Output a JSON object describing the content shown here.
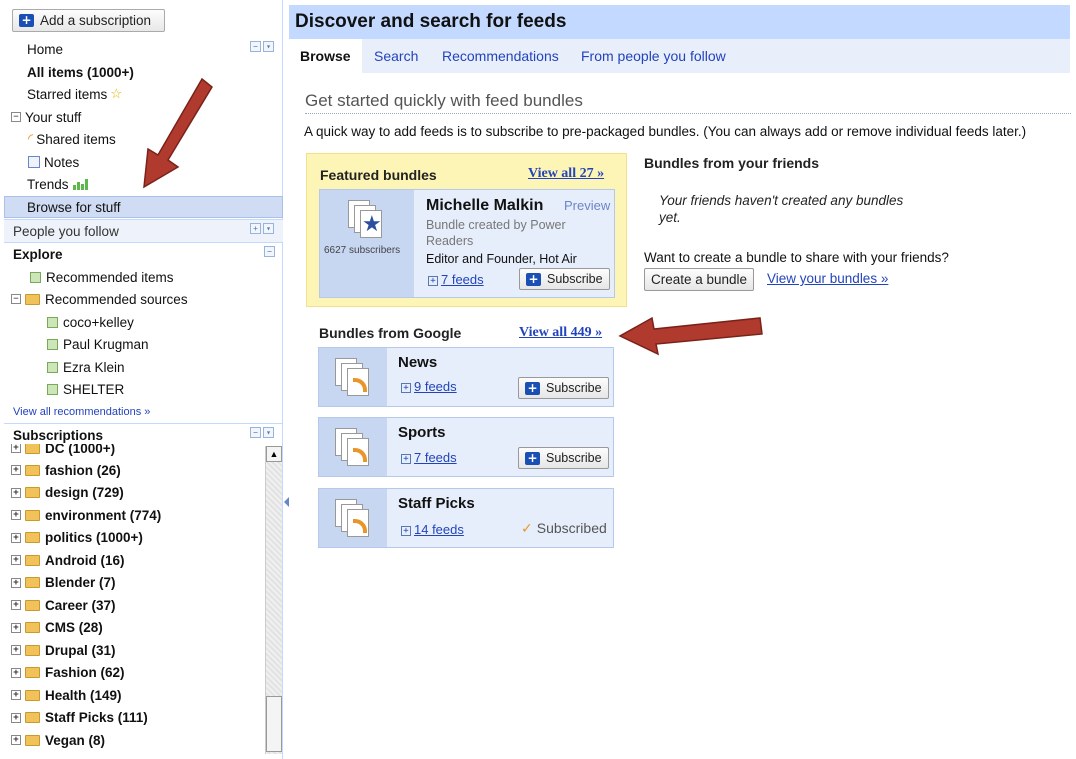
{
  "sidebar": {
    "add_subscription": "Add a subscription",
    "nav": {
      "home": "Home",
      "all_items": "All items (1000+)",
      "starred": "Starred items",
      "your_stuff": "Your stuff",
      "shared": "Shared items",
      "notes": "Notes",
      "trends": "Trends",
      "browse": "Browse for stuff"
    },
    "people_you_follow": "People you follow",
    "explore": {
      "title": "Explore",
      "recommended_items": "Recommended items",
      "recommended_sources": "Recommended sources",
      "sources": [
        "coco+kelley",
        "Paul Krugman",
        "Ezra Klein",
        "SHELTER"
      ],
      "view_all": "View all recommendations »"
    },
    "subscriptions": {
      "title": "Subscriptions",
      "partial": "DC (1000+)",
      "folders": [
        "fashion (26)",
        "design (729)",
        "environment (774)",
        "politics (1000+)",
        "Android (16)",
        "Blender (7)",
        "Career (37)",
        "CMS (28)",
        "Drupal (31)",
        "Fashion (62)",
        "Health (149)",
        "Staff Picks (111)",
        "Vegan (8)"
      ]
    }
  },
  "main": {
    "title": "Discover and search for feeds",
    "tabs": [
      "Browse",
      "Search",
      "Recommendations",
      "From people you follow"
    ],
    "heading": "Get started quickly with feed bundles",
    "intro": "A quick way to add feeds is to subscribe to pre-packaged bundles. (You can always add or remove individual feeds later.)",
    "featured": {
      "title": "Featured bundles",
      "view_all": "View all 27 »",
      "bundle": {
        "name": "Michelle Malkin",
        "preview": "Preview",
        "by": "Bundle created by Power Readers",
        "desc": "Editor and Founder, Hot Air",
        "subscribers": "6627 subscribers",
        "feeds": "7 feeds",
        "subscribe": "Subscribe"
      }
    },
    "friends": {
      "title": "Bundles from your friends",
      "none": "Your friends haven't created any bundles yet.",
      "want": "Want to create a bundle to share with your friends?",
      "create": "Create a bundle",
      "view_yours": "View your bundles »"
    },
    "google": {
      "title": "Bundles from Google",
      "view_all": "View all 449 »",
      "bundles": [
        {
          "name": "News",
          "feeds": "9 feeds",
          "action": "Subscribe"
        },
        {
          "name": "Sports",
          "feeds": "7 feeds",
          "action": "Subscribe"
        },
        {
          "name": "Staff Picks",
          "feeds": "14 feeds",
          "action": "Subscribed"
        }
      ]
    }
  },
  "colors": {
    "header_bg": "#c3d9ff",
    "link": "#2244bb",
    "featured_bg": "#fdf5b5",
    "annotation_arrow": "#b03a2e"
  }
}
